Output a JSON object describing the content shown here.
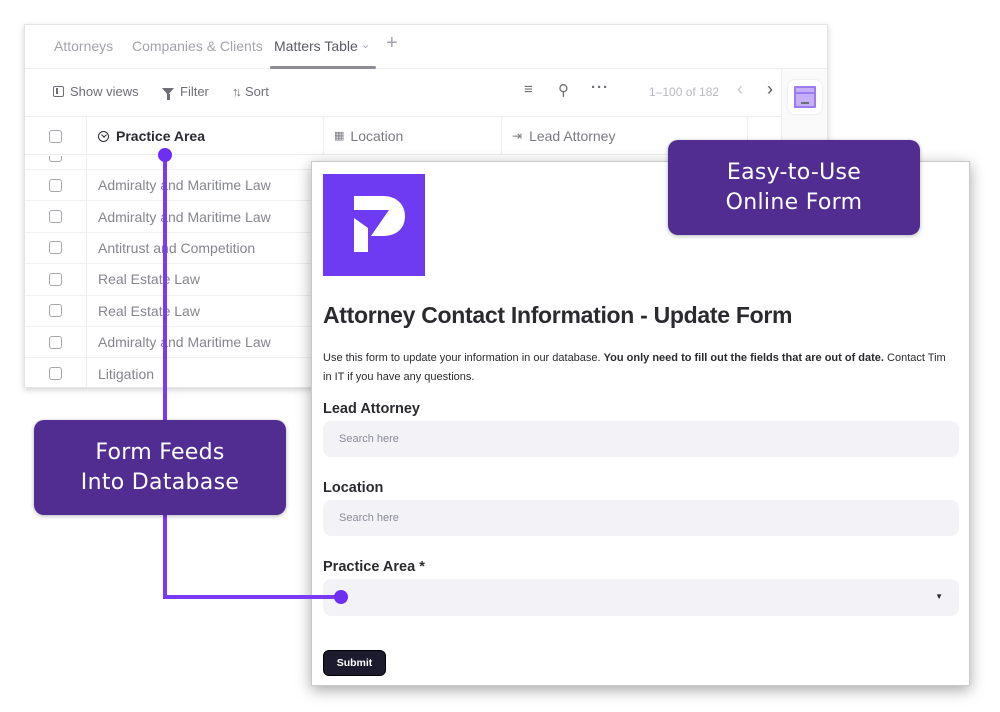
{
  "database": {
    "tabs": [
      {
        "label": "Attorneys",
        "active": false
      },
      {
        "label": "Companies & Clients",
        "active": false
      },
      {
        "label": "Matters Table",
        "active": true
      }
    ],
    "add_tab_icon": "plus-icon",
    "toolbar": {
      "show_views": "Show views",
      "filter": "Filter",
      "sort": "Sort",
      "pagination": "1–100 of 182"
    },
    "columns": [
      {
        "label": "Practice Area",
        "icon": "circle-chevron-icon"
      },
      {
        "label": "Location",
        "icon": "grid-check-icon"
      },
      {
        "label": "Lead Attorney",
        "icon": "link-record-icon"
      }
    ],
    "rows": [
      {
        "practice_area": "Admiralty and Maritime Law"
      },
      {
        "practice_area": "Admiralty and Maritime Law"
      },
      {
        "practice_area": "Antitrust and Competition"
      },
      {
        "practice_area": "Real Estate Law"
      },
      {
        "practice_area": "Real Estate Law"
      },
      {
        "practice_area": "Admiralty and Maritime Law"
      },
      {
        "practice_area": "Litigation"
      }
    ]
  },
  "form": {
    "title": "Attorney Contact Information - Update Form",
    "description_start": "Use this form to update your information in our database. ",
    "description_bold": "You only need to fill out the fields that are out of date.",
    "description_end": " Contact Tim in IT if you have any questions.",
    "fields": [
      {
        "label": "Lead Attorney",
        "placeholder": "Search here",
        "value": ""
      },
      {
        "label": "Location",
        "placeholder": "Search here",
        "value": ""
      },
      {
        "label": "Practice Area *",
        "type": "select",
        "value": ""
      }
    ],
    "submit_label": "Submit"
  },
  "callouts": {
    "top_line1": "Easy-to-Use",
    "top_line2": "Online Form",
    "left_line1": "Form Feeds",
    "left_line2": "Into Database"
  },
  "colors": {
    "brand_purple": "#6e3bf2",
    "callout_purple": "#522d91",
    "connector": "#7a3af5"
  }
}
